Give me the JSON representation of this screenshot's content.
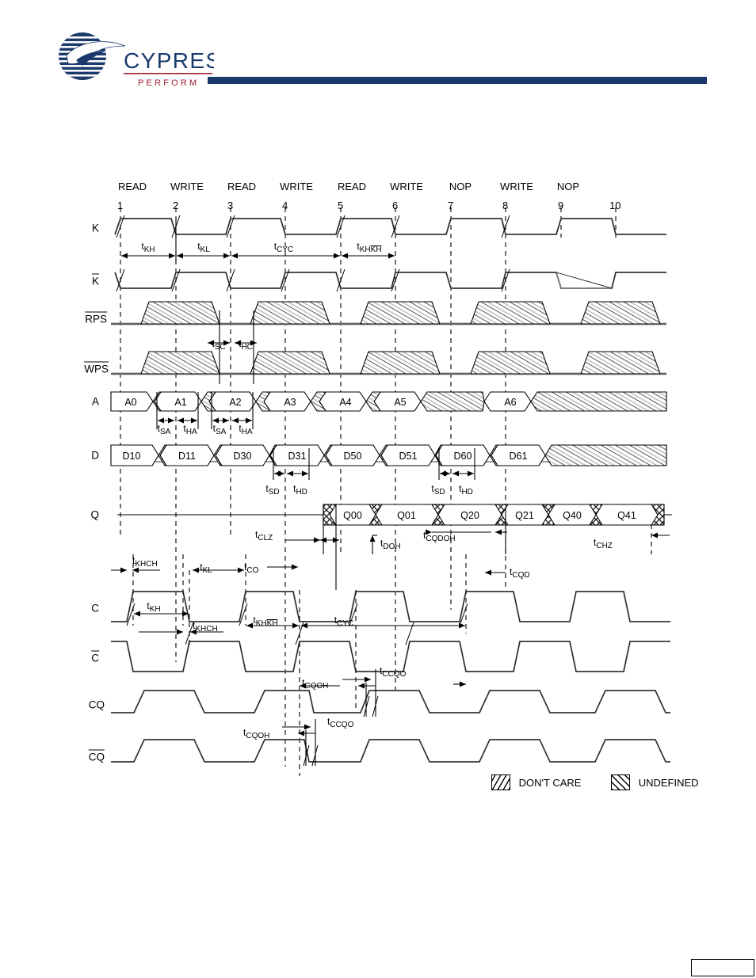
{
  "document": {
    "brand": "CYPRESS",
    "brand_tagline": "PERFORM",
    "accent_color": "#1b3a6b",
    "logo_underline_color": "#9b1b30"
  },
  "diagram": {
    "title": "",
    "cycle_operations": [
      "READ",
      "WRITE",
      "READ",
      "WRITE",
      "READ",
      "WRITE",
      "NOP",
      "WRITE",
      "NOP",
      ""
    ],
    "cycle_numbers": [
      "1",
      "2",
      "3",
      "4",
      "5",
      "6",
      "7",
      "8",
      "9",
      "10"
    ],
    "signals": [
      {
        "name": "K",
        "overbar": false
      },
      {
        "name": "K",
        "overbar": true
      },
      {
        "name": "RPS",
        "overbar": true
      },
      {
        "name": "WPS",
        "overbar": true
      },
      {
        "name": "A",
        "overbar": false
      },
      {
        "name": "D",
        "overbar": false
      },
      {
        "name": "Q",
        "overbar": false
      },
      {
        "name": "C",
        "overbar": false
      },
      {
        "name": "C",
        "overbar": true
      },
      {
        "name": "CQ",
        "overbar": false
      },
      {
        "name": "CQ",
        "overbar": true
      }
    ],
    "address_values": [
      "A0",
      "A1",
      "A2",
      "A3",
      "A4",
      "A5",
      "A6"
    ],
    "data_values": [
      "D10",
      "D11",
      "D30",
      "D31",
      "D50",
      "D51",
      "D60",
      "D61"
    ],
    "q_values": [
      "Q00",
      "Q01",
      "Q20",
      "Q21",
      "Q40",
      "Q41"
    ],
    "timing_params": [
      {
        "base": "t",
        "sub": "KH",
        "row": "K"
      },
      {
        "base": "t",
        "sub": "KL",
        "row": "K"
      },
      {
        "base": "t",
        "sub": "CYC",
        "row": "K"
      },
      {
        "base": "t",
        "sub": "KHKH",
        "row": "K",
        "sub_overbar": "KH"
      },
      {
        "base": "t",
        "sub": "SC",
        "row": "RPS/WPS"
      },
      {
        "base": "t",
        "sub": "HC",
        "row": "RPS/WPS"
      },
      {
        "base": "t",
        "sub": "SA",
        "row": "A"
      },
      {
        "base": "t",
        "sub": "HA",
        "row": "A"
      },
      {
        "base": "t",
        "sub": "SD",
        "row": "D"
      },
      {
        "base": "t",
        "sub": "HD",
        "row": "D"
      },
      {
        "base": "t",
        "sub": "CLZ",
        "row": "Q"
      },
      {
        "base": "t",
        "sub": "DOH",
        "row": "Q"
      },
      {
        "base": "t",
        "sub": "CQDOH",
        "row": "Q"
      },
      {
        "base": "t",
        "sub": "CHZ",
        "row": "Q"
      },
      {
        "base": "t",
        "sub": "CO",
        "row": "C"
      },
      {
        "base": "t",
        "sub": "CQD",
        "row": "C"
      },
      {
        "base": "t",
        "sub": "KHCH",
        "row": "C"
      },
      {
        "base": "t",
        "sub": "CQOH",
        "row": "CQ"
      },
      {
        "base": "t",
        "sub": "CCQO",
        "row": "CQ"
      }
    ],
    "legend": [
      {
        "label": "DON'T CARE",
        "pattern": "diagonal-hatch"
      },
      {
        "label": "UNDEFINED",
        "pattern": "cross-hatch"
      }
    ]
  }
}
